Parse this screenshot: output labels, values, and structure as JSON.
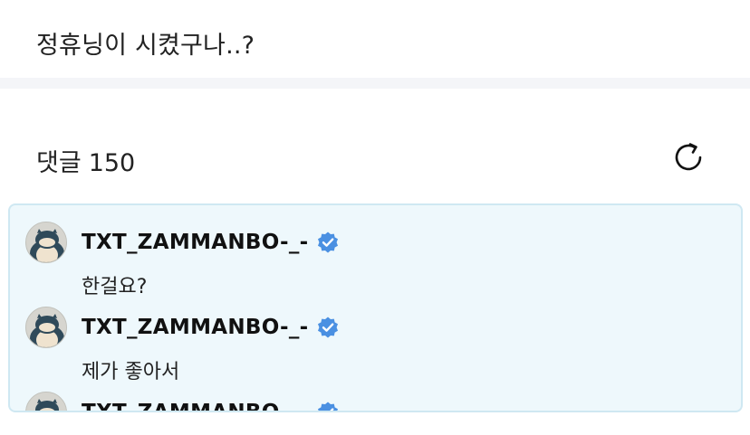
{
  "post": {
    "text": "정휴닝이 시켰구나..?"
  },
  "comments_section": {
    "title": "댓글",
    "count": "150",
    "refresh_icon": "refresh-icon"
  },
  "thread": {
    "comments": [
      {
        "username": "TXT_ZAMMANBO-_-",
        "verified": true,
        "text": "한걸요?"
      },
      {
        "username": "TXT_ZAMMANBO-_-",
        "verified": true,
        "text": "제가 좋아서"
      },
      {
        "username": "TXT_ZAMMANBO-_-",
        "verified": true,
        "text": ""
      }
    ]
  },
  "colors": {
    "thread_bg": "#eef8fc",
    "thread_border": "#cfe8f2",
    "verified_badge": "#4a90e2"
  }
}
